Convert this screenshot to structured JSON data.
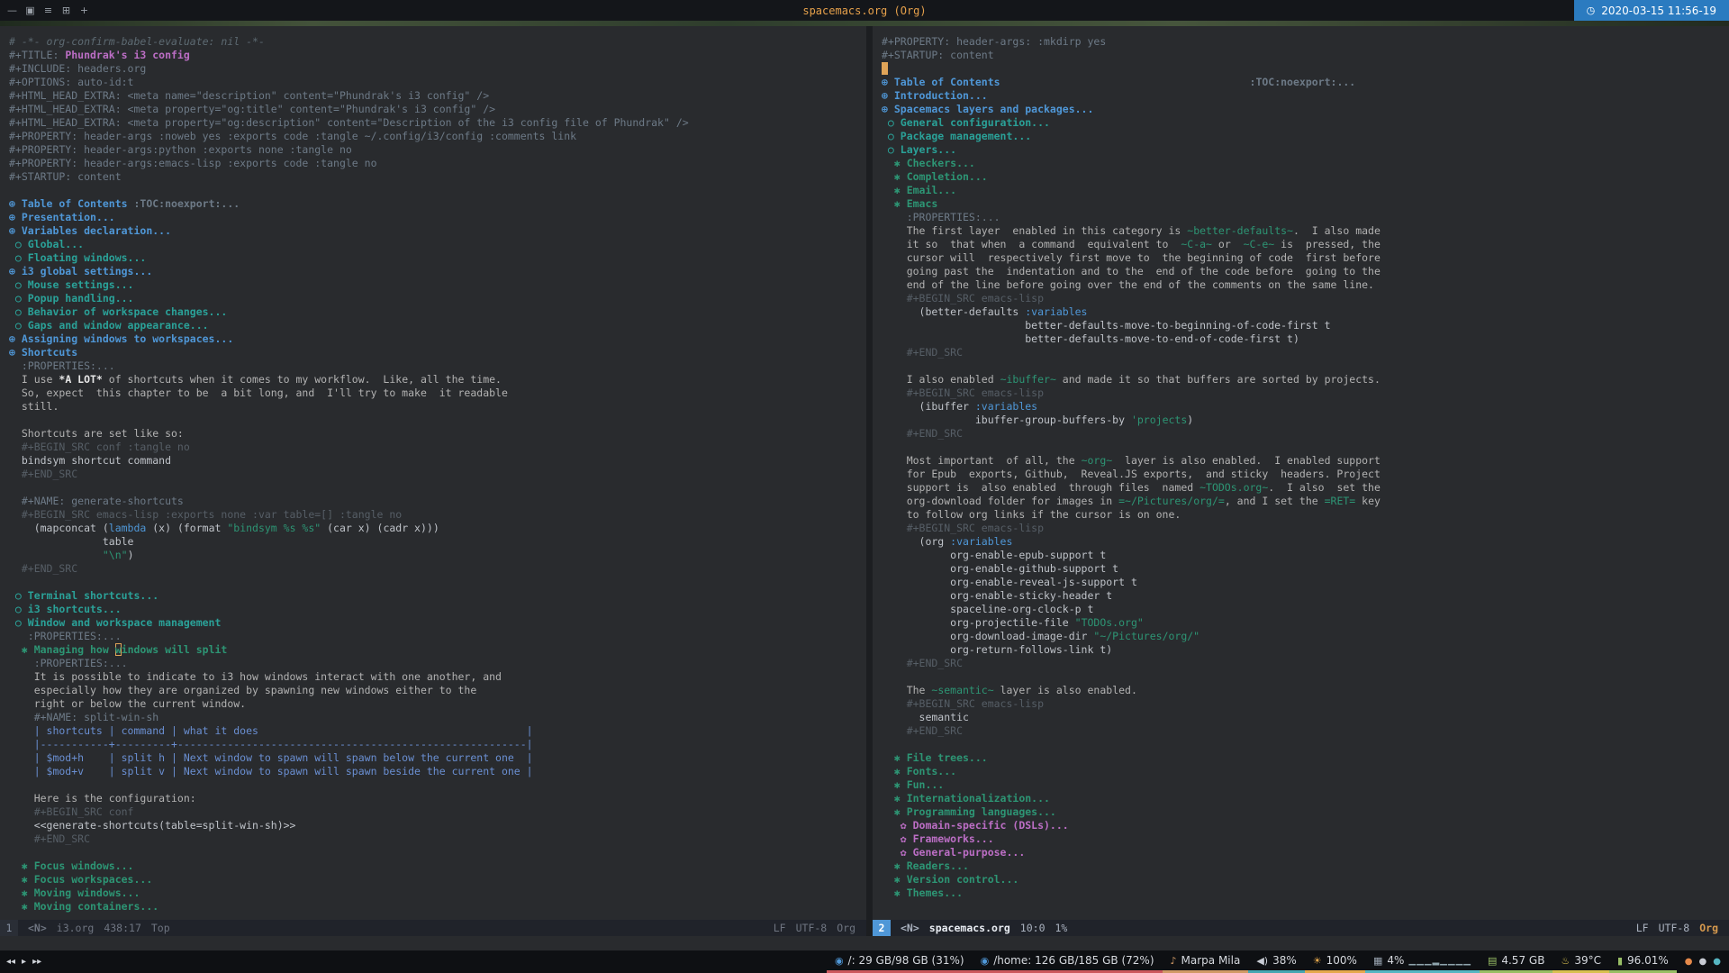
{
  "colors": {
    "editor_bg": "#292b2e",
    "editor_fg": "#b2b2b2",
    "accent_blue": "#4f97d7",
    "cursor": "#e0a458",
    "title_orange": "#e5a04b",
    "clock_bg": "#2b7bc0"
  },
  "topbar": {
    "window_icons": [
      "—",
      "▣",
      "≡",
      "⊞",
      "+"
    ],
    "title": "spacemacs.org (Org)",
    "clock_glyph": "◷",
    "clock": "2020-03-15 11:56-19"
  },
  "modeline_left": {
    "win": "1",
    "state": "<N>",
    "buffer": "i3.org",
    "position": "438:17",
    "percent": "Top",
    "eol": "LF",
    "encoding": "UTF-8",
    "mode": "Org"
  },
  "modeline_right": {
    "win": "2",
    "state": "<N>",
    "buffer": "spacemacs.org",
    "position": "10:0",
    "percent": "1%",
    "eol": "LF",
    "encoding": "UTF-8",
    "mode": "Org"
  },
  "left_buffer": {
    "lines": [
      [
        [
          "cm",
          "# -*- org-confirm-babel-evaluate: nil -*-"
        ]
      ],
      [
        [
          "mt",
          "#+TITLE: "
        ],
        [
          "doc",
          "Phundrak's i3 config"
        ]
      ],
      [
        [
          "mt",
          "#+INCLUDE: headers.org"
        ]
      ],
      [
        [
          "mt",
          "#+OPTIONS: auto-id:t"
        ]
      ],
      [
        [
          "mt",
          "#+HTML_HEAD_EXTRA: <meta name=\"description\" content=\"Phundrak's i3 config\" />"
        ]
      ],
      [
        [
          "mt",
          "#+HTML_HEAD_EXTRA: <meta property=\"og:title\" content=\"Phundrak's i3 config\" />"
        ]
      ],
      [
        [
          "mt",
          "#+HTML_HEAD_EXTRA: <meta property=\"og:description\" content=\"Description of the i3 config file of Phundrak\" />"
        ]
      ],
      [
        [
          "mt",
          "#+PROPERTY: header-args :noweb yes :exports code :tangle ~/.config/i3/config :comments link"
        ]
      ],
      [
        [
          "mt",
          "#+PROPERTY: header-args:python :exports none :tangle no"
        ]
      ],
      [
        [
          "mt",
          "#+PROPERTY: header-args:emacs-lisp :exports code :tangle no"
        ]
      ],
      [
        [
          "mt",
          "#+STARTUP: content"
        ]
      ],
      [],
      [
        [
          "h1",
          "⊕ Table of Contents "
        ],
        [
          "tag",
          ":TOC:noexport:..."
        ]
      ],
      [
        [
          "h1",
          "⊕ Presentation..."
        ]
      ],
      [
        [
          "h1",
          "⊕ Variables declaration..."
        ]
      ],
      [
        [
          "h2",
          " ○ Global..."
        ]
      ],
      [
        [
          "h2",
          " ○ Floating windows..."
        ]
      ],
      [
        [
          "h1",
          "⊕ i3 global settings..."
        ]
      ],
      [
        [
          "h2",
          " ○ Mouse settings..."
        ]
      ],
      [
        [
          "h2",
          " ○ Popup handling..."
        ]
      ],
      [
        [
          "h2",
          " ○ Behavior of workspace changes..."
        ]
      ],
      [
        [
          "h2",
          " ○ Gaps and window appearance..."
        ]
      ],
      [
        [
          "h1",
          "⊕ Assigning windows to workspaces..."
        ]
      ],
      [
        [
          "h1",
          "⊕ Shortcuts"
        ]
      ],
      [
        [
          "drw",
          "  :PROPERTIES:..."
        ]
      ],
      [
        [
          "txt",
          "  I use "
        ],
        [
          "bold",
          "*A LOT*"
        ],
        [
          "txt",
          " of shortcuts when it comes to my workflow.  Like, all the time."
        ]
      ],
      [
        [
          "txt",
          "  So, expect  this chapter to be  a bit long, and  I'll try to make  it readable"
        ]
      ],
      [
        [
          "txt",
          "  still."
        ]
      ],
      [],
      [
        [
          "txt",
          "  Shortcuts are set like so:"
        ]
      ],
      [
        [
          "srcm",
          "  #+BEGIN_SRC conf :tangle no"
        ]
      ],
      [
        [
          "src",
          "  bindsym shortcut command"
        ]
      ],
      [
        [
          "srcm",
          "  #+END_SRC"
        ]
      ],
      [],
      [
        [
          "mt",
          "  #+NAME: generate-shortcuts"
        ]
      ],
      [
        [
          "srcm",
          "  #+BEGIN_SRC emacs-lisp :exports none :var table=[] :tangle no"
        ]
      ],
      [
        [
          "src",
          "    (mapconcat ("
        ],
        [
          "kw",
          "lambda"
        ],
        [
          "src",
          " (x) (format "
        ],
        [
          "str",
          "\"bindsym %s %s\""
        ],
        [
          "src",
          " (car x) (cadr x)))"
        ]
      ],
      [
        [
          "src",
          "               table"
        ]
      ],
      [
        [
          "src",
          "               "
        ],
        [
          "str",
          "\"\\n\""
        ],
        [
          "src",
          ")"
        ]
      ],
      [
        [
          "srcm",
          "  #+END_SRC"
        ]
      ],
      [],
      [
        [
          "h2",
          " ○ Terminal shortcuts..."
        ]
      ],
      [
        [
          "h2",
          " ○ i3 shortcuts..."
        ]
      ],
      [
        [
          "h2",
          " ○ Window and workspace management"
        ]
      ],
      [
        [
          "drw",
          "   :PROPERTIES:..."
        ]
      ],
      [
        [
          "h3",
          "  ✱ Managing how "
        ],
        [
          "hcur",
          "w"
        ],
        [
          "h3",
          "indows will split"
        ]
      ],
      [
        [
          "drw",
          "    :PROPERTIES:..."
        ]
      ],
      [
        [
          "txt",
          "    It is possible to indicate to i3 how windows interact with one another, and"
        ]
      ],
      [
        [
          "txt",
          "    especially how they are organized by spawning new windows either to the"
        ]
      ],
      [
        [
          "txt",
          "    right or below the current window."
        ]
      ],
      [
        [
          "mt",
          "    #+NAME: split-win-sh"
        ]
      ],
      [
        [
          "tbl",
          "    | shortcuts | command | what it does                                           |"
        ]
      ],
      [
        [
          "tbl",
          "    |-----------+---------+--------------------------------------------------------|"
        ]
      ],
      [
        [
          "tbl",
          "    | $mod+h    | split h | Next window to spawn will spawn below the current one  |"
        ]
      ],
      [
        [
          "tbl",
          "    | $mod+v    | split v | Next window to spawn will spawn beside the current one |"
        ]
      ],
      [],
      [
        [
          "txt",
          "    Here is the configuration:"
        ]
      ],
      [
        [
          "srcm",
          "    #+BEGIN_SRC conf"
        ]
      ],
      [
        [
          "src",
          "    <<generate-shortcuts(table=split-win-sh)>>"
        ]
      ],
      [
        [
          "srcm",
          "    #+END_SRC"
        ]
      ],
      [],
      [
        [
          "h3",
          "  ✱ Focus windows..."
        ]
      ],
      [
        [
          "h3",
          "  ✱ Focus workspaces..."
        ]
      ],
      [
        [
          "h3",
          "  ✱ Moving windows..."
        ]
      ],
      [
        [
          "h3",
          "  ✱ Moving containers..."
        ]
      ]
    ]
  },
  "right_buffer": {
    "lines": [
      [
        [
          "mt",
          "#+PROPERTY: header-args: :mkdirp yes"
        ]
      ],
      [
        [
          "mt",
          "#+STARTUP: content"
        ]
      ],
      [
        [
          "cur",
          " "
        ]
      ],
      [
        [
          "h1",
          "⊕ Table of Contents"
        ],
        [
          "txt",
          "                                        "
        ],
        [
          "tag",
          ":TOC:noexport:..."
        ]
      ],
      [
        [
          "h1",
          "⊕ Introduction..."
        ]
      ],
      [
        [
          "h1",
          "⊕ Spacemacs layers and packages..."
        ]
      ],
      [
        [
          "h2",
          " ○ General configuration..."
        ]
      ],
      [
        [
          "h2",
          " ○ Package management..."
        ]
      ],
      [
        [
          "h2",
          " ○ Layers..."
        ]
      ],
      [
        [
          "h3",
          "  ✱ Checkers..."
        ]
      ],
      [
        [
          "h3",
          "  ✱ Completion..."
        ]
      ],
      [
        [
          "h3",
          "  ✱ Email..."
        ]
      ],
      [
        [
          "h3",
          "  ✱ Emacs"
        ]
      ],
      [
        [
          "drw",
          "    :PROPERTIES:..."
        ]
      ],
      [
        [
          "txt",
          "    The first layer  enabled in this category is "
        ],
        [
          "code",
          "~better-defaults~"
        ],
        [
          "txt",
          ".  I also made"
        ]
      ],
      [
        [
          "txt",
          "    it so  that when  a command  equivalent to  "
        ],
        [
          "code",
          "~C-a~"
        ],
        [
          "txt",
          " or  "
        ],
        [
          "code",
          "~C-e~"
        ],
        [
          "txt",
          " is  pressed, the"
        ]
      ],
      [
        [
          "txt",
          "    cursor will  respectively first move to  the beginning of code  first before"
        ]
      ],
      [
        [
          "txt",
          "    going past the  indentation and to the  end of the code before  going to the"
        ]
      ],
      [
        [
          "txt",
          "    end of the line before going over the end of the comments on the same line."
        ]
      ],
      [
        [
          "srcm",
          "    #+BEGIN_SRC emacs-lisp"
        ]
      ],
      [
        [
          "src",
          "      (better-defaults "
        ],
        [
          "kw",
          ":variables"
        ]
      ],
      [
        [
          "src",
          "                       better-defaults-move-to-beginning-of-code-first t"
        ]
      ],
      [
        [
          "src",
          "                       better-defaults-move-to-end-of-code-first t)"
        ]
      ],
      [
        [
          "srcm",
          "    #+END_SRC"
        ]
      ],
      [],
      [
        [
          "txt",
          "    I also enabled "
        ],
        [
          "code",
          "~ibuffer~"
        ],
        [
          "txt",
          " and made it so that buffers are sorted by projects."
        ]
      ],
      [
        [
          "srcm",
          "    #+BEGIN_SRC emacs-lisp"
        ]
      ],
      [
        [
          "src",
          "      (ibuffer "
        ],
        [
          "kw",
          ":variables"
        ]
      ],
      [
        [
          "src",
          "               ibuffer-group-buffers-by "
        ],
        [
          "str",
          "'projects"
        ],
        [
          "src",
          ")"
        ]
      ],
      [
        [
          "srcm",
          "    #+END_SRC"
        ]
      ],
      [],
      [
        [
          "txt",
          "    Most important  of all, the "
        ],
        [
          "code",
          "~org~"
        ],
        [
          "txt",
          "  layer is also enabled.  I enabled support"
        ]
      ],
      [
        [
          "txt",
          "    for Epub  exports, Github,  Reveal.JS exports,  and sticky  headers. Project"
        ]
      ],
      [
        [
          "txt",
          "    support is  also enabled  through files  named "
        ],
        [
          "code",
          "~TODOs.org~"
        ],
        [
          "txt",
          ".  I also  set the"
        ]
      ],
      [
        [
          "txt",
          "    org-download folder for images in "
        ],
        [
          "verb",
          "=~/Pictures/org/="
        ],
        [
          "txt",
          ", and I set the "
        ],
        [
          "verb",
          "=RET="
        ],
        [
          "txt",
          " key"
        ]
      ],
      [
        [
          "txt",
          "    to follow org links if the cursor is on one."
        ]
      ],
      [
        [
          "srcm",
          "    #+BEGIN_SRC emacs-lisp"
        ]
      ],
      [
        [
          "src",
          "      (org "
        ],
        [
          "kw",
          ":variables"
        ]
      ],
      [
        [
          "src",
          "           org-enable-epub-support t"
        ]
      ],
      [
        [
          "src",
          "           org-enable-github-support t"
        ]
      ],
      [
        [
          "src",
          "           org-enable-reveal-js-support t"
        ]
      ],
      [
        [
          "src",
          "           org-enable-sticky-header t"
        ]
      ],
      [
        [
          "src",
          "           spaceline-org-clock-p t"
        ]
      ],
      [
        [
          "src",
          "           org-projectile-file "
        ],
        [
          "str",
          "\"TODOs.org\""
        ]
      ],
      [
        [
          "src",
          "           org-download-image-dir "
        ],
        [
          "str",
          "\"~/Pictures/org/\""
        ]
      ],
      [
        [
          "src",
          "           org-return-follows-link t)"
        ]
      ],
      [
        [
          "srcm",
          "    #+END_SRC"
        ]
      ],
      [],
      [
        [
          "txt",
          "    The "
        ],
        [
          "code",
          "~semantic~"
        ],
        [
          "txt",
          " layer is also enabled."
        ]
      ],
      [
        [
          "srcm",
          "    #+BEGIN_SRC emacs-lisp"
        ]
      ],
      [
        [
          "src",
          "      semantic"
        ]
      ],
      [
        [
          "srcm",
          "    #+END_SRC"
        ]
      ],
      [],
      [
        [
          "h3",
          "  ✱ File trees..."
        ]
      ],
      [
        [
          "h3",
          "  ✱ Fonts..."
        ]
      ],
      [
        [
          "h3",
          "  ✱ Fun..."
        ]
      ],
      [
        [
          "h3",
          "  ✱ Internationalization..."
        ]
      ],
      [
        [
          "h3",
          "  ✱ Programming languages..."
        ]
      ],
      [
        [
          "h4",
          "   ✿ Domain-specific (DSLs)..."
        ]
      ],
      [
        [
          "h4",
          "   ✿ Frameworks..."
        ]
      ],
      [
        [
          "h4",
          "   ✿ General-purpose..."
        ]
      ],
      [
        [
          "h3",
          "  ✱ Readers..."
        ]
      ],
      [
        [
          "h3",
          "  ✱ Version control..."
        ]
      ],
      [
        [
          "h3",
          "  ✱ Themes..."
        ]
      ]
    ]
  },
  "statusbar": {
    "media": [
      {
        "name": "previous-track",
        "glyph": "◂◂"
      },
      {
        "name": "play-pause",
        "glyph": "▸"
      },
      {
        "name": "next-track",
        "glyph": "▸▸"
      }
    ],
    "segments": [
      {
        "name": "disk-root",
        "icon": "◉",
        "icon_color": "#4f97d7",
        "text": "/: 29 GB/98 GB (31%)",
        "accent": "#cc575d"
      },
      {
        "name": "disk-home",
        "icon": "◉",
        "icon_color": "#4f97d7",
        "text": "/home: 126 GB/185 GB (72%)",
        "accent": "#cc575d"
      },
      {
        "name": "now-playing",
        "icon": "♪",
        "icon_color": "#d19a66",
        "text": "Marpa Mila",
        "accent": "#d19a66"
      },
      {
        "name": "volume",
        "icon": "◀)",
        "icon_color": "#c8ccd4",
        "text": "38%",
        "accent": "#46a6b2"
      },
      {
        "name": "brightness",
        "icon": "☀",
        "icon_color": "#e5a84c",
        "text": "100%",
        "accent": "#e5a84c"
      },
      {
        "name": "cpu",
        "icon": "▦",
        "icon_color": "#9aa5b1",
        "text": "4%",
        "extra": "▁▁▁▂▁▁▁▁",
        "accent": "#56b6c2"
      },
      {
        "name": "memory",
        "icon": "▤",
        "icon_color": "#98be65",
        "text": "4.57 GB",
        "accent": "#98be65"
      },
      {
        "name": "temperature",
        "icon": "♨",
        "icon_color": "#d8c04f",
        "text": "39°C",
        "accent": "#d8c04f"
      },
      {
        "name": "battery",
        "icon": "▮",
        "icon_color": "#98be65",
        "text": "96.01%",
        "accent": "#98be65"
      }
    ],
    "tray": [
      {
        "name": "tray-redshift",
        "glyph": "●",
        "color": "#e5894a"
      },
      {
        "name": "tray-network",
        "glyph": "●",
        "color": "#c8ccd4"
      },
      {
        "name": "tray-bluetooth",
        "glyph": "●",
        "color": "#56b6c2"
      }
    ]
  }
}
